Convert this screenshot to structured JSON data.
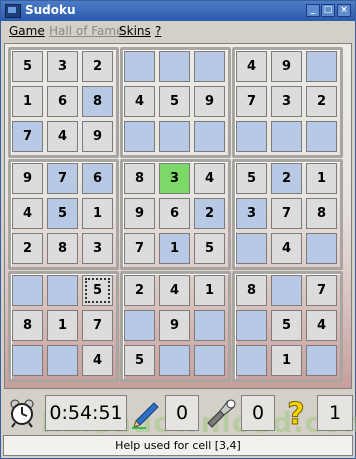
{
  "window": {
    "title": "Sudoku",
    "controls": {
      "minimize": "_",
      "maximize": "□",
      "close": "×"
    }
  },
  "menu": [
    {
      "label": "Game",
      "enabled": true
    },
    {
      "label": "Hall of Fame",
      "enabled": false
    },
    {
      "label": "Skins",
      "enabled": true
    },
    {
      "label": "?",
      "enabled": true
    }
  ],
  "board": {
    "rows": [
      [
        {
          "v": "5",
          "s": "given"
        },
        {
          "v": "3",
          "s": "given"
        },
        {
          "v": "2",
          "s": "given"
        },
        {
          "v": "",
          "s": "empty"
        },
        {
          "v": "",
          "s": "empty"
        },
        {
          "v": "",
          "s": "empty"
        },
        {
          "v": "4",
          "s": "given"
        },
        {
          "v": "9",
          "s": "given"
        },
        {
          "v": "",
          "s": "empty"
        }
      ],
      [
        {
          "v": "1",
          "s": "given"
        },
        {
          "v": "6",
          "s": "given"
        },
        {
          "v": "8",
          "s": "user"
        },
        {
          "v": "4",
          "s": "given"
        },
        {
          "v": "5",
          "s": "given"
        },
        {
          "v": "9",
          "s": "given"
        },
        {
          "v": "7",
          "s": "given"
        },
        {
          "v": "3",
          "s": "given"
        },
        {
          "v": "2",
          "s": "given"
        }
      ],
      [
        {
          "v": "7",
          "s": "user"
        },
        {
          "v": "4",
          "s": "given"
        },
        {
          "v": "9",
          "s": "given"
        },
        {
          "v": "",
          "s": "empty"
        },
        {
          "v": "",
          "s": "empty"
        },
        {
          "v": "",
          "s": "empty"
        },
        {
          "v": "",
          "s": "empty"
        },
        {
          "v": "",
          "s": "empty"
        },
        {
          "v": "",
          "s": "empty"
        }
      ],
      [
        {
          "v": "9",
          "s": "given"
        },
        {
          "v": "7",
          "s": "user"
        },
        {
          "v": "6",
          "s": "user"
        },
        {
          "v": "8",
          "s": "given"
        },
        {
          "v": "3",
          "s": "hint"
        },
        {
          "v": "4",
          "s": "given"
        },
        {
          "v": "5",
          "s": "given"
        },
        {
          "v": "2",
          "s": "user"
        },
        {
          "v": "1",
          "s": "given"
        }
      ],
      [
        {
          "v": "4",
          "s": "given"
        },
        {
          "v": "5",
          "s": "user"
        },
        {
          "v": "1",
          "s": "given"
        },
        {
          "v": "9",
          "s": "given"
        },
        {
          "v": "6",
          "s": "given"
        },
        {
          "v": "2",
          "s": "user"
        },
        {
          "v": "3",
          "s": "user"
        },
        {
          "v": "7",
          "s": "given"
        },
        {
          "v": "8",
          "s": "given"
        }
      ],
      [
        {
          "v": "2",
          "s": "given"
        },
        {
          "v": "8",
          "s": "given"
        },
        {
          "v": "3",
          "s": "given"
        },
        {
          "v": "7",
          "s": "given"
        },
        {
          "v": "1",
          "s": "user"
        },
        {
          "v": "5",
          "s": "given"
        },
        {
          "v": "",
          "s": "empty"
        },
        {
          "v": "4",
          "s": "given"
        },
        {
          "v": "",
          "s": "empty"
        }
      ],
      [
        {
          "v": "",
          "s": "empty"
        },
        {
          "v": "",
          "s": "empty"
        },
        {
          "v": "5",
          "s": "selected"
        },
        {
          "v": "2",
          "s": "given"
        },
        {
          "v": "4",
          "s": "given"
        },
        {
          "v": "1",
          "s": "given"
        },
        {
          "v": "8",
          "s": "given"
        },
        {
          "v": "",
          "s": "empty"
        },
        {
          "v": "7",
          "s": "given"
        }
      ],
      [
        {
          "v": "8",
          "s": "given"
        },
        {
          "v": "1",
          "s": "given"
        },
        {
          "v": "7",
          "s": "given"
        },
        {
          "v": "",
          "s": "empty"
        },
        {
          "v": "9",
          "s": "given"
        },
        {
          "v": "",
          "s": "empty"
        },
        {
          "v": "",
          "s": "empty"
        },
        {
          "v": "5",
          "s": "given"
        },
        {
          "v": "4",
          "s": "given"
        }
      ],
      [
        {
          "v": "",
          "s": "empty"
        },
        {
          "v": "",
          "s": "empty"
        },
        {
          "v": "4",
          "s": "given"
        },
        {
          "v": "5",
          "s": "given"
        },
        {
          "v": "",
          "s": "empty"
        },
        {
          "v": "",
          "s": "empty"
        },
        {
          "v": "",
          "s": "empty"
        },
        {
          "v": "1",
          "s": "given"
        },
        {
          "v": "",
          "s": "empty"
        }
      ]
    ]
  },
  "status": {
    "timer_icon": "alarm-clock-icon",
    "timer": "0:54:51",
    "pencil_icon": "pencil-icon",
    "pencil_count": "0",
    "flashlight_icon": "flashlight-icon",
    "flashlight_count": "0",
    "help_icon": "question-mark-icon",
    "help_count": "1"
  },
  "help_text": "Help used for cell [3,4]",
  "watermark": "limeadownload.com",
  "colors": {
    "title_bar": "#2a5aad",
    "given_cell": "#dcdcdc",
    "user_cell": "#b7c9e5",
    "hint_cell": "#7cd967",
    "help_icon": "#f5d300"
  }
}
